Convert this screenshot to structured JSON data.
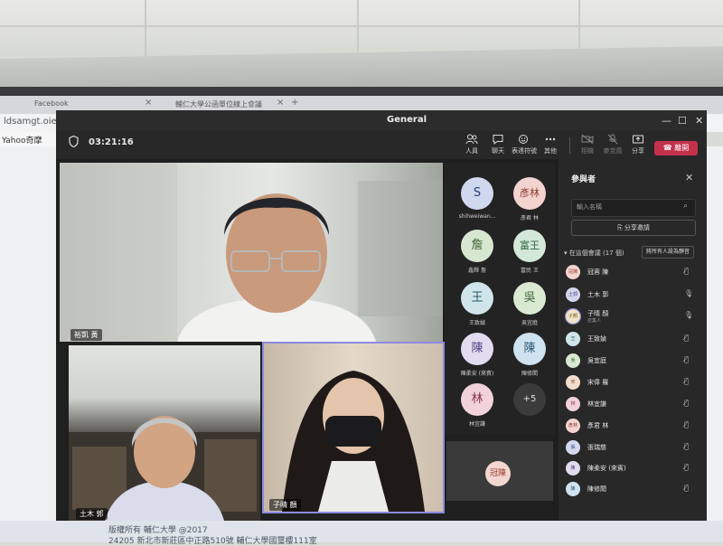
{
  "browser": {
    "tabs": [
      {
        "title": "Facebook"
      },
      {
        "title": "輔仁大學公函單位線上會議"
      }
    ],
    "address": "ldsamgt.oie.fju",
    "bookmark": "Yahoo奇摩"
  },
  "footer": {
    "line1": "版權所有 輔仁大學 @2017",
    "line2": "24205 新北市新莊區中正路510號 輔仁大學國璽樓111室"
  },
  "window": {
    "title": "General",
    "minimize": "—",
    "maximize": "☐",
    "close": "✕"
  },
  "toolbar": {
    "timer": "03:21:16",
    "items": [
      {
        "label": "人員",
        "icon": "people-icon"
      },
      {
        "label": "聊天",
        "icon": "chat-icon"
      },
      {
        "label": "表達符號",
        "icon": "reactions-icon"
      },
      {
        "label": "其他",
        "icon": "more-icon"
      },
      {
        "label": "相機",
        "icon": "camera-off-icon"
      },
      {
        "label": "麥克風",
        "icon": "mic-off-icon"
      },
      {
        "label": "分享",
        "icon": "share-icon"
      }
    ],
    "leave_label": "離開"
  },
  "video": {
    "main_name": "裕凱 黃",
    "bottom_left_name": "土木 郭",
    "bottom_right_name": "子晴 顏"
  },
  "avatars": [
    {
      "initials": "S",
      "name": "shihweiwan...",
      "bg": "#cfd8ee",
      "fg": "#2b3f7a"
    },
    {
      "initials": "彥林",
      "name": "彥君 林",
      "bg": "#f3d3cf",
      "fg": "#8b3a2e"
    },
    {
      "initials": "詹",
      "name": "鑫輝 詹",
      "bg": "#d7e6d0",
      "fg": "#3d6233"
    },
    {
      "initials": "富王",
      "name": "富民 王",
      "bg": "#d3e8d8",
      "fg": "#2f6642"
    },
    {
      "initials": "王",
      "name": "王致媜",
      "bg": "#cfe5ea",
      "fg": "#2a5c66"
    },
    {
      "initials": "吳",
      "name": "吳宜庭",
      "bg": "#d9e9d2",
      "fg": "#45683a"
    },
    {
      "initials": "陳",
      "name": "陳柔安 (來賓)",
      "bg": "#e1dcef",
      "fg": "#4f3f7e"
    },
    {
      "initials": "陳",
      "name": "陳修閎",
      "bg": "#cfe2ef",
      "fg": "#2c5673"
    },
    {
      "initials": "林",
      "name": "林宜謙",
      "bg": "#f1d2da",
      "fg": "#8a3148"
    },
    {
      "initials": "+5",
      "name": "",
      "bg": "#3b3b3b",
      "fg": "#dddddd"
    }
  ],
  "self_tile": {
    "initials": "冠陳"
  },
  "panel": {
    "title": "參與者",
    "close": "✕",
    "search_placeholder": "輸入名稱",
    "invite_label": "分享邀請",
    "section_header": "在這個會議 (17 個)",
    "mute_all_label": "將所有人設為靜音",
    "participants": [
      {
        "initials": "冠陳",
        "name": "冠蓉 陳",
        "sub": "",
        "bg": "#f2d6d0",
        "fg": "#9b3a2c",
        "mic": "muted"
      },
      {
        "initials": "土郭",
        "name": "土木 郭",
        "sub": "",
        "bg": "#d5d6ee",
        "fg": "#3d3f7a",
        "mic": "on"
      },
      {
        "initials": "子顏",
        "name": "子晴 顏",
        "sub": "召集人",
        "bg": "#efe4c8",
        "fg": "#7a5a12",
        "mic": "on"
      },
      {
        "initials": "王",
        "name": "王致媜",
        "sub": "",
        "bg": "#cfe5ea",
        "fg": "#2a5c66",
        "mic": "muted"
      },
      {
        "initials": "吳",
        "name": "吳宜庭",
        "sub": "",
        "bg": "#d9e9d2",
        "fg": "#45683a",
        "mic": "muted"
      },
      {
        "initials": "宋",
        "name": "宋偉 羅",
        "sub": "",
        "bg": "#f3dccc",
        "fg": "#8a4a22",
        "mic": "muted"
      },
      {
        "initials": "林",
        "name": "林宜謙",
        "sub": "",
        "bg": "#f1d2da",
        "fg": "#8a3148",
        "mic": "muted"
      },
      {
        "initials": "彥林",
        "name": "彥君 林",
        "sub": "",
        "bg": "#f3d3cf",
        "fg": "#8b3a2e",
        "mic": "muted"
      },
      {
        "initials": "張",
        "name": "張瑞慈",
        "sub": "",
        "bg": "#d3d9ef",
        "fg": "#35407a",
        "mic": "muted"
      },
      {
        "initials": "陳",
        "name": "陳柔安 (來賓)",
        "sub": "",
        "bg": "#e1dcef",
        "fg": "#4f3f7e",
        "mic": "muted"
      },
      {
        "initials": "陳",
        "name": "陳修閎",
        "sub": "",
        "bg": "#cfe2ef",
        "fg": "#2c5673",
        "mic": "muted"
      }
    ]
  }
}
